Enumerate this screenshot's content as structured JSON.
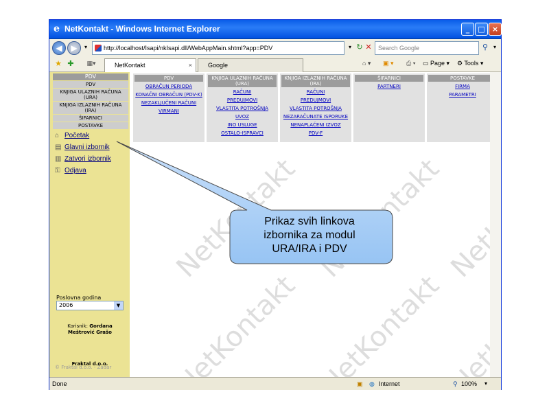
{
  "window": {
    "title": "NetKontakt - Windows Internet Explorer"
  },
  "navbar": {
    "address": "http://localhost/Isapi/nkIsapi.dll/WebAppMain.shtml?app=PDV",
    "search_placeholder": "Search Google"
  },
  "tabs": [
    {
      "label": "NetKontakt"
    },
    {
      "label": "Google"
    }
  ],
  "toolbar": {
    "page_label": "Page",
    "tools_label": "Tools"
  },
  "sidebar": {
    "nav": [
      "PDV",
      "PDV",
      "KNJIGA ULAZNIH RAČUNA (URA)",
      "KNJIGA IZLAZNIH RAČUNA (IRA)",
      "ŠIFARNICI",
      "POSTAVKE"
    ],
    "links": [
      {
        "label": "Početak",
        "icon": "home-icon"
      },
      {
        "label": "Glavni izbornik",
        "icon": "menu-icon"
      },
      {
        "label": "Zatvori izbornik",
        "icon": "close-menu-icon"
      },
      {
        "label": "Odjava",
        "icon": "logout-icon"
      }
    ],
    "year_label": "Poslovna godina",
    "year_value": "2006",
    "user_label": "Korisnik:",
    "user_name": "Gordana Meštrović Grašo",
    "company": "Fraktal d.o.o.",
    "copyright": "© Fraktal d.o.o. - Zadar"
  },
  "menu": [
    {
      "header": "PDV",
      "links": [
        "OBRAČUN PERIODA",
        "KONAČNI OBRAČUN (PDV-K)",
        "NEZAKLJUČENI RAČUNI",
        "VIRMANI"
      ]
    },
    {
      "header": "KNJIGA ULAZNIH RAČUNA (URA)",
      "links": [
        "RAČUNI",
        "PREDUJMOVI",
        "VLASTITA POTROŠNJA",
        "UVOZ",
        "INO USLUGE",
        "OSTALO-ISPRAVCI"
      ]
    },
    {
      "header": "KNJIGA IZLAZNIH RAČUNA (IRA)",
      "links": [
        "RAČUNI",
        "PREDUJMOVI",
        "VLASTITA POTROŠNJA",
        "NEZARAČUNATE ISPORUKE",
        "NENAPLAĆENI IZVOZ",
        "PDV-F"
      ]
    },
    {
      "header": "ŠIFARNICI",
      "links": [
        "PARTNERI"
      ]
    },
    {
      "header": "POSTAVKE",
      "links": [
        "FIRMA",
        "PARAMETRI"
      ]
    }
  ],
  "watermark": "NetKontakt",
  "callout": {
    "line1": "Prikaz svih linkova",
    "line2": "izbornika za modul",
    "line3": "URA/IRA i PDV"
  },
  "status": {
    "left": "Done",
    "zone": "Internet",
    "zoom": "100%"
  }
}
